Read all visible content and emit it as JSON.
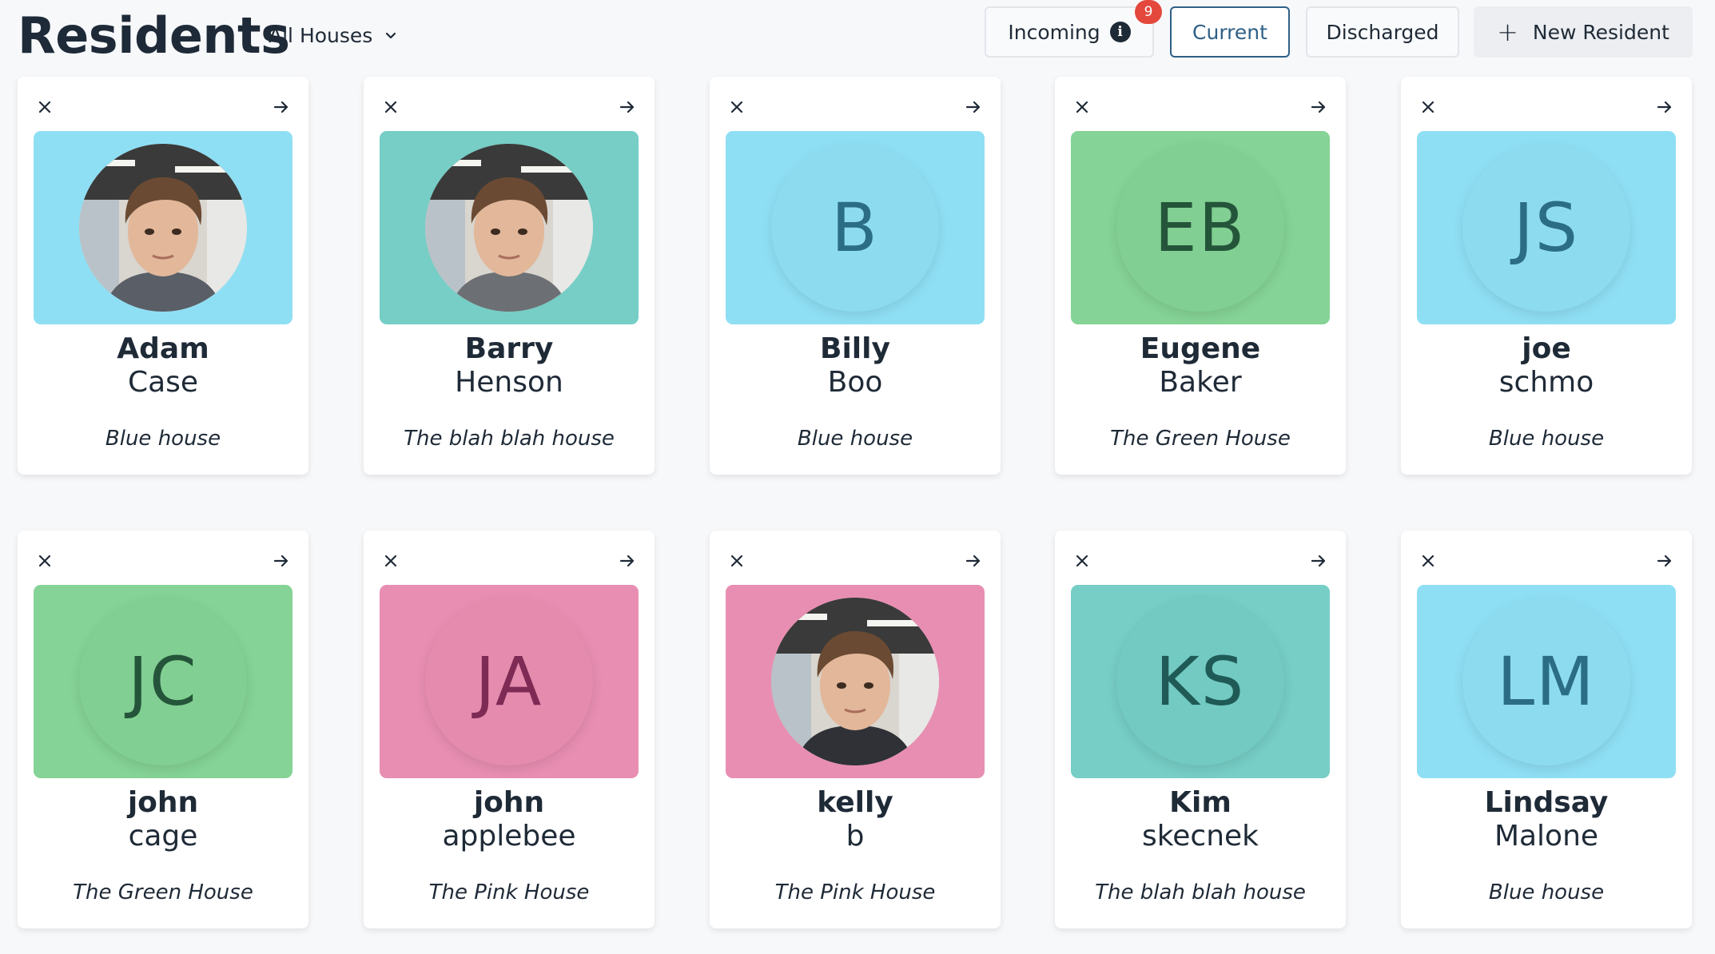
{
  "header": {
    "title": "Residents",
    "house_filter": "All Houses",
    "tabs": {
      "incoming": "Incoming",
      "incoming_badge": "9",
      "current": "Current",
      "discharged": "Discharged"
    },
    "new_resident": "New Resident",
    "info_glyph": "i",
    "plus_glyph": "+"
  },
  "colors": {
    "blue": "#8fdff4",
    "teal": "#76cec6",
    "green": "#85d396",
    "pink": "#e88eb2",
    "accent": "#2e5f86",
    "badge": "#e4473c"
  },
  "residents": [
    {
      "first": "Adam",
      "last": "Case",
      "house": "Blue house",
      "initials": "",
      "color": "#8fdff4",
      "circle": "",
      "text": "",
      "photo": true
    },
    {
      "first": "Barry",
      "last": "Henson",
      "house": "The blah blah house",
      "initials": "",
      "color": "#76cec6",
      "circle": "",
      "text": "",
      "photo": true
    },
    {
      "first": "Billy",
      "last": "Boo",
      "house": "Blue house",
      "initials": "B",
      "color": "#8fdff4",
      "circle": "#8ddbef",
      "text": "#2c6d86",
      "photo": false
    },
    {
      "first": "Eugene",
      "last": "Baker",
      "house": "The Green House",
      "initials": "EB",
      "color": "#85d396",
      "circle": "#81cf92",
      "text": "#24553a",
      "photo": false
    },
    {
      "first": "joe",
      "last": "schmo",
      "house": "Blue house",
      "initials": "JS",
      "color": "#8fdff4",
      "circle": "#8ddbef",
      "text": "#2c6d86",
      "photo": false
    },
    {
      "first": "john",
      "last": "cage",
      "house": "The Green House",
      "initials": "JC",
      "color": "#85d396",
      "circle": "#81cf92",
      "text": "#24553a",
      "photo": false
    },
    {
      "first": "john",
      "last": "applebee",
      "house": "The Pink House",
      "initials": "JA",
      "color": "#e88eb2",
      "circle": "#e58cae",
      "text": "#7d2a55",
      "photo": false
    },
    {
      "first": "kelly",
      "last": "b",
      "house": "The Pink House",
      "initials": "",
      "color": "#e88eb2",
      "circle": "",
      "text": "",
      "photo": true
    },
    {
      "first": "Kim",
      "last": "skecnek",
      "house": "The blah blah house",
      "initials": "KS",
      "color": "#76cec6",
      "circle": "#72cac2",
      "text": "#1f5a56",
      "photo": false
    },
    {
      "first": "Lindsay",
      "last": "Malone",
      "house": "Blue house",
      "initials": "LM",
      "color": "#8fdff4",
      "circle": "#8ddbef",
      "text": "#2c6d86",
      "photo": false
    }
  ],
  "icons": {
    "close": "close-icon",
    "open": "arrow-right-icon",
    "chevron": "chevron-down-icon",
    "info": "info-icon",
    "plus": "plus-icon"
  }
}
